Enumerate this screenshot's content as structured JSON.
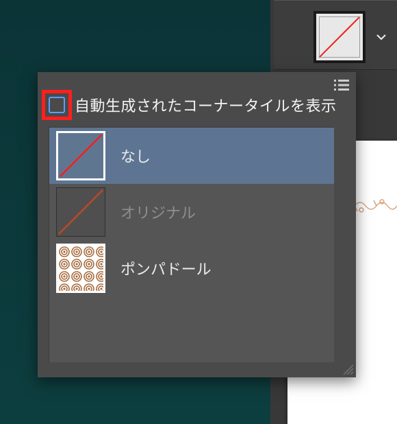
{
  "swatch_strip": {
    "current_swatch_name": "none-swatch"
  },
  "flyout": {
    "checkbox_label": "自動生成されたコーナータイルを表示",
    "items": [
      {
        "label": "なし",
        "selected": true,
        "dim": false,
        "thumb": "none"
      },
      {
        "label": "オリジナル",
        "selected": false,
        "dim": true,
        "thumb": "original"
      },
      {
        "label": "ポンパドール",
        "selected": false,
        "dim": false,
        "thumb": "pompadour"
      }
    ]
  },
  "colors": {
    "highlight": "#ff1f1f",
    "selected_row": "#5d7592"
  }
}
